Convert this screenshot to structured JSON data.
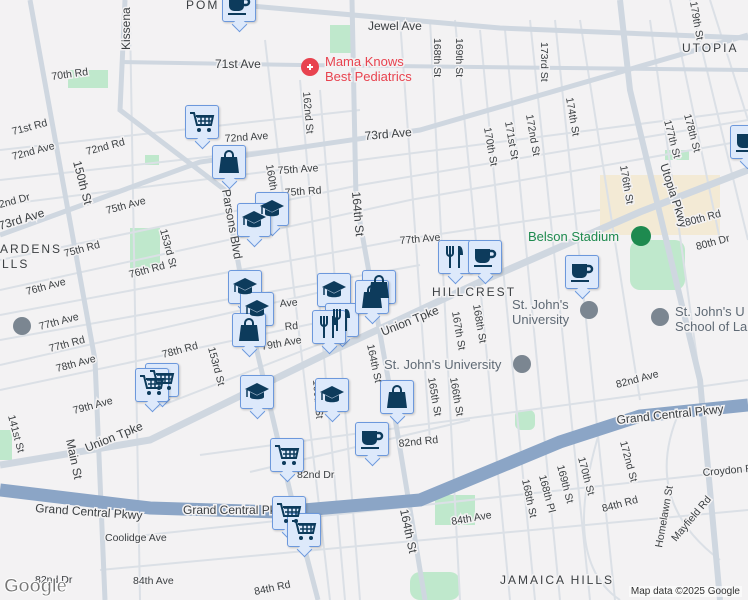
{
  "map": {
    "neighborhoods": [
      "POM",
      "UTOPIA",
      "HILLCREST",
      "JAMAICA HILLS",
      "ARDENS",
      "LLS"
    ],
    "streets": [
      "Jewel Ave",
      "71st Ave",
      "70th Rd",
      "Kissena",
      "71st Rd",
      "72nd Ave",
      "72nd Rd",
      "72nd Ave",
      "73rd Ave",
      "73rd Ave",
      "150th St",
      "75th Ave",
      "75th Ave",
      "75th Rd",
      "75th Rd",
      "76th Rd",
      "153rd St",
      "Parsons Blvd",
      "160th St",
      "162nd St",
      "164th St",
      "76th Ave",
      "77th Ave",
      "77th Rd",
      "78th Rd",
      "78th Ave",
      "79th Ave",
      "Union Tpke",
      "Union Tpke",
      "Main St",
      "Grand Central Pkwy",
      "Grand Central Pkwy",
      "Grand Central Pkwy",
      "Coolidge Ave",
      "84th Ave",
      "84th Ave",
      "84th Rd",
      "82nd Dr",
      "82nd Dr",
      "82nd Rd",
      "164th St",
      "164th St",
      "165th St",
      "166th St",
      "167th St",
      "168th St",
      "168th St",
      "168th St",
      "169th St",
      "170th St",
      "171st St",
      "172nd St",
      "173rd St",
      "174th St",
      "176th St",
      "177th St",
      "178th St",
      "179th St",
      "Utopia Pkwy",
      "80th Rd",
      "80th Dr",
      "82nd Ave",
      "168th Pl",
      "169th St",
      "170th St",
      "172nd St",
      "Homelawn St",
      "84th Rd",
      "Mayfield Rd",
      "Croydon Rd",
      "141st St",
      "153rd St",
      "160th St",
      "79th Ave",
      "77th Ave",
      "2nd Dr",
      "Ave",
      "Rd"
    ],
    "pois": {
      "pediatrics_line1": "Mama Knows",
      "pediatrics_line2": "Best Pediatrics",
      "stadium": "Belson Stadium",
      "sju1_line1": "St. John's",
      "sju1_line2": "University",
      "sju2": "St. John's University",
      "law_line1": "St. John's U",
      "law_line2": "School of La"
    },
    "markers": [
      "coffee",
      "shopping-cart",
      "shopping-bag",
      "graduation-cap",
      "graduation-cap",
      "graduation-cap",
      "graduation-cap",
      "shopping-bag",
      "graduation-cap",
      "shopping-bag",
      "restaurant",
      "restaurant",
      "shopping-bag",
      "restaurant",
      "coffee",
      "coffee",
      "coffee",
      "shopping-cart",
      "shopping-cart",
      "graduation-cap",
      "graduation-cap",
      "shopping-bag",
      "coffee",
      "shopping-cart",
      "shopping-cart",
      "shopping-cart"
    ],
    "colors": {
      "marker_bg": "#dde9fb",
      "marker_border": "#6c98dc",
      "marker_icon": "#0d3b5c",
      "highway": "#8ba5c6",
      "poi_red": "#e8434f",
      "poi_green": "#1e8a4f"
    }
  },
  "footer": {
    "logo": "Google",
    "attribution": "Map data ©2025 Google"
  }
}
